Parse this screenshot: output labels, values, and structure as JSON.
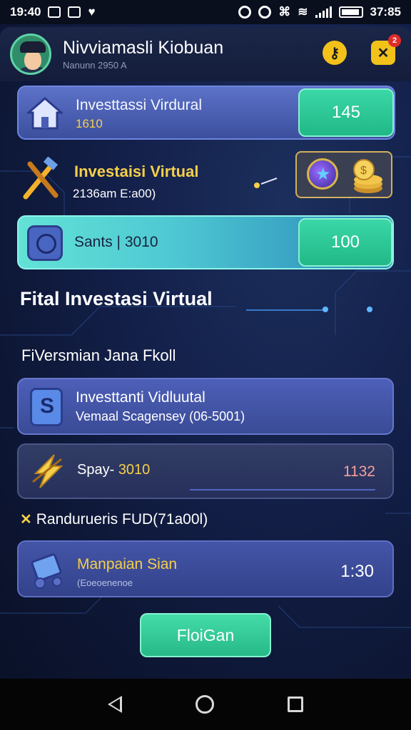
{
  "status_bar": {
    "time": "19:40",
    "clock_right": "37:85"
  },
  "header": {
    "title": "Nivviamasli Kiobuan",
    "subtitle": "Nanunn 2950 A",
    "notification_count": "2"
  },
  "cards": {
    "top": {
      "title": "Investtassi Virdural",
      "sub": "1610",
      "value": "145"
    },
    "row2": {
      "title": "Investaisi Virtual",
      "sub": "2136am E:a00)"
    },
    "teal": {
      "title": "Sants | 3010",
      "value": "100"
    }
  },
  "section_title": "Fital Investasi Virtual",
  "sub_heading": "FiVersmian Jana Fkoll",
  "list": {
    "item1": {
      "title": "Investtanti Vidluutal",
      "sub": "Vemaal Scagensey (06-5001)"
    },
    "item2": {
      "title_prefix": "Spay- ",
      "title_num": "3010",
      "value": "1132"
    }
  },
  "random_row": "Randurueris FUD(71a00l)",
  "card6": {
    "title": "Manpaian Sian",
    "sub": "(Eoeoenenoe",
    "value": "1:30"
  },
  "main_button": "FloiGan",
  "colors": {
    "accent_green": "#2cc896",
    "accent_gold": "#f6cf4a",
    "card_blue": "#4a5db5",
    "bg_dark": "#0d1634"
  },
  "icons": [
    "house-icon",
    "tools-icon",
    "badge-icon",
    "coins-icon",
    "chat-icon",
    "s-shield-icon",
    "lightning-icon",
    "wallet-icon",
    "help-icon",
    "close-icon"
  ]
}
